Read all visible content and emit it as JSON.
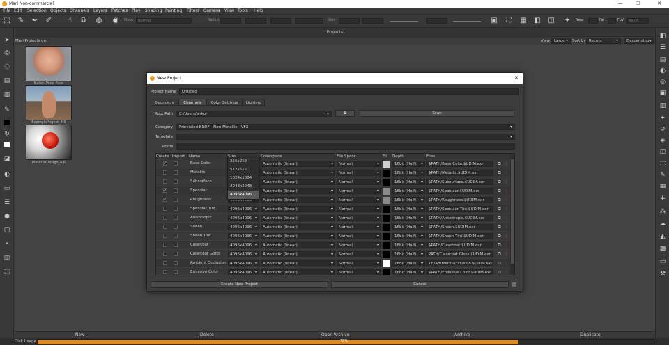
{
  "window": {
    "title": "Mari Non-commercial",
    "minimize": "—",
    "maximize": "☐",
    "close": "✕"
  },
  "menu": [
    "File",
    "Edit",
    "Selection",
    "Objects",
    "Channels",
    "Layers",
    "Patches",
    "Play",
    "Shading",
    "Painting",
    "Filters",
    "Camera",
    "View",
    "Tools",
    "Help"
  ],
  "toolbar": {
    "mode_label": "Mode",
    "mode_value": "Normal",
    "radius_label": "Radius",
    "gain_label": "Gain",
    "fov_near": "Near",
    "fov_far": "Far",
    "fov_label": "FoV",
    "fov_value": "45.00"
  },
  "projects": {
    "header": "Projects",
    "location": "Mari Projects on",
    "view_label": "View",
    "view_value": "Large",
    "sort_label": "Sort by",
    "sort_value": "Recent",
    "order_value": "Descending",
    "items": [
      {
        "name": "Ballet_Pose_Face"
      },
      {
        "name": "ExampleProject_4.6"
      },
      {
        "name": "MaterialDesign_4.6"
      }
    ],
    "actions": {
      "new": "New",
      "delete": "Delete",
      "open_archive": "Open Archive",
      "archive": "Archive",
      "duplicate": "Duplicate"
    }
  },
  "disk": {
    "label": "Disk Usage",
    "percent_text": "78%",
    "percent": 78,
    "bar_color": "#e08a1a"
  },
  "dialog": {
    "title": "New Project",
    "close": "✕",
    "project_name_label": "Project Name",
    "project_name_value": "Untitled",
    "tabs": [
      "Geometry",
      "Channels",
      "Color Settings",
      "Lighting"
    ],
    "active_tab": "Channels",
    "root_path_label": "Root Path",
    "root_path_value": "C:/Users/ankur",
    "scan_label": "Scan",
    "category_label": "Category",
    "category_value": "Principled BRDF - Non-Metallic - VFX",
    "template_label": "Template",
    "template_value": "",
    "prefix_label": "Prefix",
    "prefix_value": "",
    "columns": {
      "create": "Create",
      "import": "Import",
      "name": "Name",
      "size": "Size",
      "colorspace": "Colorspace",
      "filespace": "File Space",
      "fill": "Fill",
      "depth": "Depth",
      "files": "Files"
    },
    "size_options": [
      "256x256",
      "512x512",
      "1024x1024",
      "2048x2048",
      "4096x4096"
    ],
    "size_selected": "4096x4096",
    "channels": [
      {
        "create": true,
        "name": "Base Color",
        "size": "4096x4096",
        "colorspace": "Automatic (linear)",
        "filespace": "Normal",
        "fill": "#cfcfcf",
        "depth": "16bit (Half)",
        "files": "$PATH/Base Color.$UDIM.exr"
      },
      {
        "create": false,
        "name": "Metallic",
        "size": "4096x4096",
        "colorspace": "Automatic (linear)",
        "filespace": "Normal",
        "fill": "#000000",
        "depth": "16bit (Half)",
        "files": "$PATH/Metallic.$UDIM.exr"
      },
      {
        "create": false,
        "name": "Subsurface",
        "size": "4096x4096",
        "colorspace": "Automatic (linear)",
        "filespace": "Normal",
        "fill": "#000000",
        "depth": "16bit (Half)",
        "files": "$PATH/Subsurface.$UDIM.exr"
      },
      {
        "create": true,
        "name": "Specular",
        "size": "4096x4096",
        "colorspace": "Automatic (linear)",
        "filespace": "Normal",
        "fill": "#8a8a8a",
        "depth": "16bit (Half)",
        "files": "$PATH/Specular.$UDIM.exr"
      },
      {
        "create": true,
        "name": "Roughness",
        "size": "4096x4096",
        "colorspace": "Automatic (linear)",
        "filespace": "Normal",
        "fill": "#8a8a8a",
        "depth": "16bit (Half)",
        "files": "$PATH/Roughness.$UDIM.exr"
      },
      {
        "create": false,
        "name": "Specular Tint",
        "size": "4096x4096",
        "colorspace": "Automatic (linear)",
        "filespace": "Normal",
        "fill": "#000000",
        "depth": "16bit (Half)",
        "files": "$PATH/Specular Tint.$UDIM.exr"
      },
      {
        "create": false,
        "name": "Anisotropic",
        "size": "4096x4096",
        "colorspace": "Automatic (linear)",
        "filespace": "Normal",
        "fill": "#000000",
        "depth": "16bit (Half)",
        "files": "$PATH/Anisotropic.$UDIM.exr"
      },
      {
        "create": false,
        "name": "Sheen",
        "size": "4096x4096",
        "colorspace": "Automatic (linear)",
        "filespace": "Normal",
        "fill": "#000000",
        "depth": "16bit (Half)",
        "files": "$PATH/Sheen.$UDIM.exr"
      },
      {
        "create": false,
        "name": "Sheen Tint",
        "size": "4096x4096",
        "colorspace": "Automatic (linear)",
        "filespace": "Normal",
        "fill": "#000000",
        "depth": "16bit (Half)",
        "files": "$PATH/Sheen Tint.$UDIM.exr"
      },
      {
        "create": false,
        "name": "Clearcoat",
        "size": "4096x4096",
        "colorspace": "Automatic (linear)",
        "filespace": "Normal",
        "fill": "#000000",
        "depth": "16bit (Half)",
        "files": "$PATH/Clearcoat.$UDIM.exr"
      },
      {
        "create": false,
        "name": "Clearcoat Gloss",
        "size": "4096x4096",
        "colorspace": "Automatic (linear)",
        "filespace": "Normal",
        "fill": "#000000",
        "depth": "16bit (Half)",
        "files": "PATH/Clearcoat Gloss.$UDIM.exr"
      },
      {
        "create": false,
        "name": "Ambient Occlusion",
        "size": "4096x4096",
        "colorspace": "Automatic (linear)",
        "filespace": "Normal",
        "fill": "#ffffff",
        "depth": "16bit (Half)",
        "files": "TH/Ambient Occlusion.$UDIM.exr"
      },
      {
        "create": false,
        "name": "Emissive Color",
        "size": "4096x4096",
        "colorspace": "Automatic (linear)",
        "filespace": "Normal",
        "fill": "#000000",
        "depth": "16bit (Half)",
        "files": "$PATH/Emissive Color.$UDIM.exr"
      }
    ],
    "create_button": "Create New Project",
    "cancel_button": "Cancel"
  }
}
